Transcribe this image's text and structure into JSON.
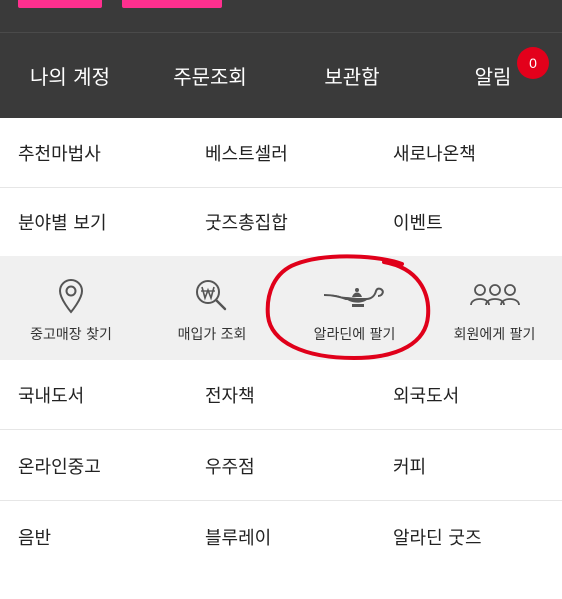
{
  "header": {
    "account_nav": [
      {
        "label": "나의 계정"
      },
      {
        "label": "주문조회"
      },
      {
        "label": "보관함"
      },
      {
        "label": "알림"
      }
    ],
    "notification_count": "0"
  },
  "menu_rows_top": [
    [
      "추천마법사",
      "베스트셀러",
      "새로나온책"
    ],
    [
      "분야별 보기",
      "굿즈총집합",
      "이벤트"
    ]
  ],
  "icon_strip": [
    {
      "label": "중고매장 찾기",
      "icon": "map-pin-icon"
    },
    {
      "label": "매입가 조회",
      "icon": "won-search-icon"
    },
    {
      "label": "알라딘에 팔기",
      "icon": "magic-lamp-icon"
    },
    {
      "label": "회원에게 팔기",
      "icon": "people-group-icon"
    }
  ],
  "menu_rows_bottom": [
    [
      "국내도서",
      "전자책",
      "외국도서"
    ],
    [
      "온라인중고",
      "우주점",
      "커피"
    ],
    [
      "음반",
      "블루레이",
      "알라딘 굿즈"
    ]
  ],
  "colors": {
    "header_bg": "#3a3a3a",
    "accent_pink": "#ff2f8e",
    "badge_red": "#e3001b",
    "strip_bg": "#f0f0f0",
    "annotation_red": "#e0001a"
  }
}
